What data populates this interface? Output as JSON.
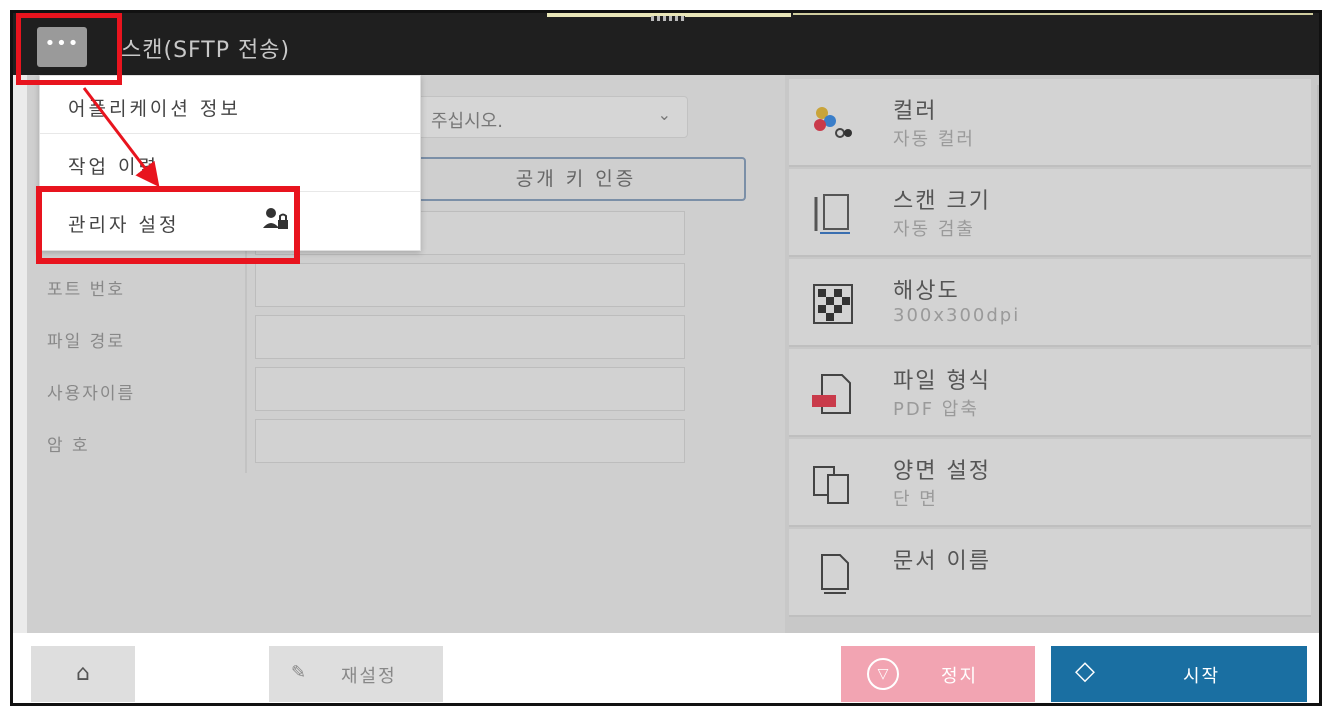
{
  "titlebar": {
    "menu_label": "•••",
    "title": "스캔(SFTP 전송)"
  },
  "left_panel": {
    "dropdown_text": "주십시오.",
    "dropdown_arrow": "⌄",
    "pubkey_button": "공개 키 인증",
    "fields": [
      {
        "label": "포트 번호",
        "value": ""
      },
      {
        "label": "파일 경로",
        "value": ""
      },
      {
        "label": "사용자이름",
        "value": ""
      },
      {
        "label": "암 호",
        "value": ""
      }
    ]
  },
  "settings": [
    {
      "title": "컬러",
      "value": "자동 컬러",
      "icon": "color-icon"
    },
    {
      "title": "스캔 크기",
      "value": "자동 검출",
      "icon": "scan-size-icon"
    },
    {
      "title": "해상도",
      "value": "300x300dpi",
      "icon": "resolution-icon"
    },
    {
      "title": "파일 형식",
      "value": "PDF 압축",
      "icon": "file-format-icon"
    },
    {
      "title": "양면 설정",
      "value": "단 면",
      "icon": "duplex-icon"
    },
    {
      "title": "문서 이름",
      "value": "",
      "icon": "document-name-icon"
    }
  ],
  "popup_menu": {
    "items": [
      {
        "label": "어플리케이션 정보"
      },
      {
        "label": "작업 이력"
      },
      {
        "label": "관리자 설정"
      }
    ],
    "admin_icon": "admin-user-icon"
  },
  "bottom_bar": {
    "home_icon": "⌂",
    "reset_label": "재설정",
    "stop_label": "정지",
    "start_label": "시작"
  },
  "colors": {
    "highlight": "#e8141e",
    "start": "#1a6fa2",
    "stop": "#f2a4b2",
    "titlebar": "#1f1f1f"
  }
}
